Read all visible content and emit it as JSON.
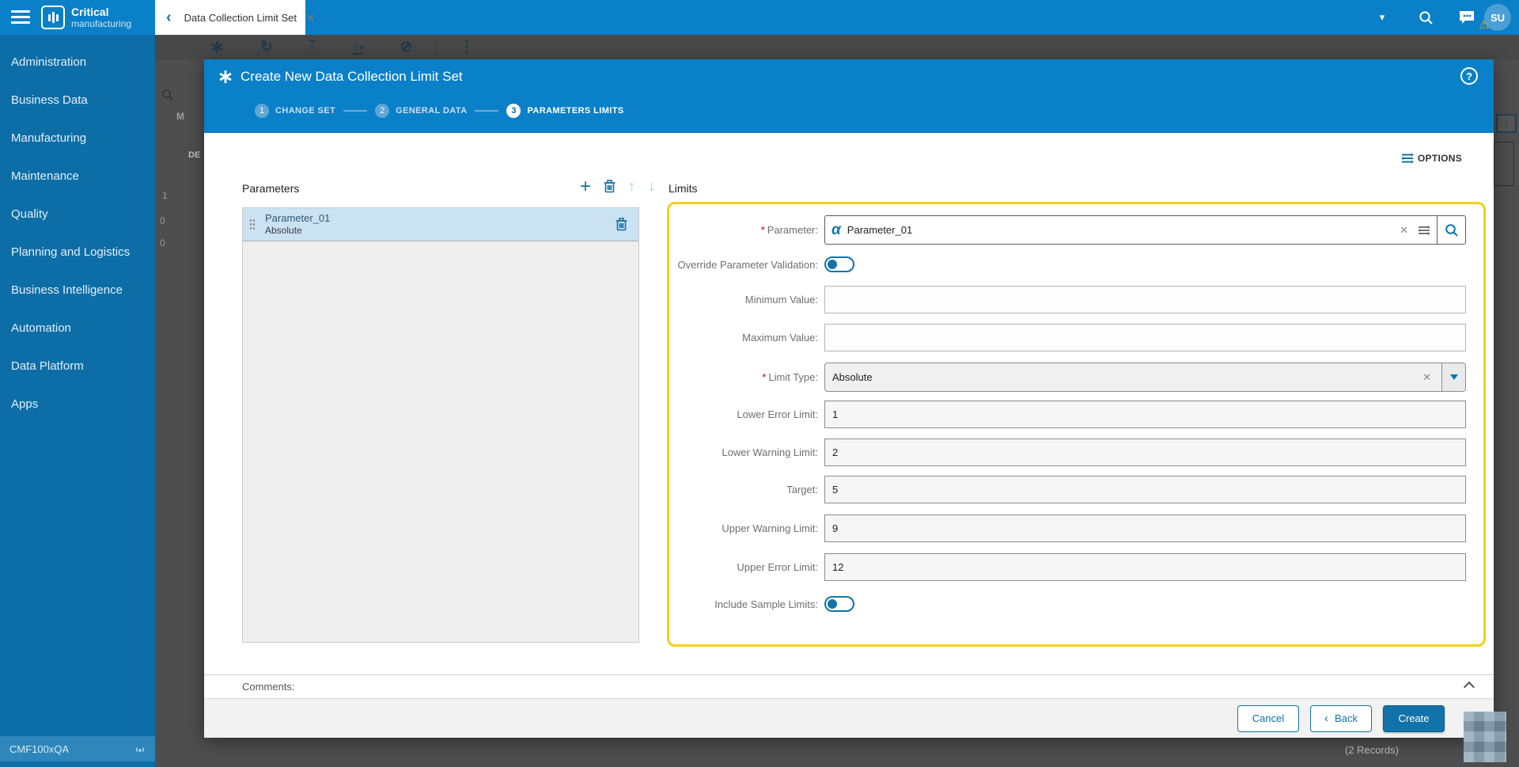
{
  "colors": {
    "accent_blue": "#1173a9",
    "topbar_blue": "#0a80c8",
    "sidebar_blue": "#0d6ea7",
    "highlight_yellow": "#f2d01e",
    "selected_row_blue": "#cbe2f2",
    "warning_orange": "#f2a900"
  },
  "topbar": {
    "logo_line1": "Critical",
    "logo_line2": "manufacturing",
    "tab_title": "Data Collection Limit Set",
    "tab_chevron": "‹",
    "tab_close": "✕",
    "caret": "▾",
    "avatar_initials": "SU",
    "avatar_warning": "⚠"
  },
  "sidebar": {
    "items": [
      "Administration",
      "Business Data",
      "Manufacturing",
      "Maintenance",
      "Quality",
      "Planning and Logistics",
      "Business Intelligence",
      "Automation",
      "Data Platform",
      "Apps"
    ],
    "environment": "CMF100xQA"
  },
  "background": {
    "toolbar_icons": [
      "new",
      "refresh",
      "upload",
      "download",
      "circle-slash",
      "more-vertical"
    ],
    "toolbar_glyphs": {
      "refresh": "↻",
      "up": "↑",
      "down": "↓",
      "caret": "▾",
      "circle_slash": "⊘",
      "dots": "⋮"
    },
    "partial_letter": "M",
    "partial_header_text": "DE",
    "partial_cell_values": [
      "1",
      "0",
      "0"
    ],
    "records_text": "(2 Records)"
  },
  "wizard": {
    "title": "Create New Data Collection Limit Set",
    "help_glyph": "?",
    "steps": [
      {
        "number": "1",
        "label": "CHANGE SET"
      },
      {
        "number": "2",
        "label": "GENERAL DATA"
      },
      {
        "number": "3",
        "label": "PARAMETERS LIMITS"
      }
    ],
    "options_label": "OPTIONS",
    "parameters_panel": {
      "title": "Parameters",
      "items": [
        {
          "name": "Parameter_01",
          "type": "Absolute"
        }
      ]
    },
    "limits_panel": {
      "title": "Limits",
      "required_marker": "*",
      "fields": {
        "parameter": {
          "label": "Parameter:",
          "value": "Parameter_01",
          "required": true
        },
        "override_parameter_validation": {
          "label": "Override Parameter Validation:",
          "value": "off"
        },
        "minimum_value": {
          "label": "Minimum Value:",
          "value": ""
        },
        "maximum_value": {
          "label": "Maximum Value:",
          "value": ""
        },
        "limit_type": {
          "label": "Limit Type:",
          "value": "Absolute",
          "required": true
        },
        "lower_error_limit": {
          "label": "Lower Error Limit:",
          "value": "1"
        },
        "lower_warning_limit": {
          "label": "Lower Warning Limit:",
          "value": "2"
        },
        "target": {
          "label": "Target:",
          "value": "5"
        },
        "upper_warning_limit": {
          "label": "Upper Warning Limit:",
          "value": "9"
        },
        "upper_error_limit": {
          "label": "Upper Error Limit:",
          "value": "12"
        },
        "include_sample_limits": {
          "label": "Include Sample Limits:",
          "value": "off"
        }
      }
    },
    "comments_label": "Comments:",
    "footer": {
      "cancel_label": "Cancel",
      "back_chevron": "‹",
      "back_label": "Back",
      "create_label": "Create"
    }
  }
}
